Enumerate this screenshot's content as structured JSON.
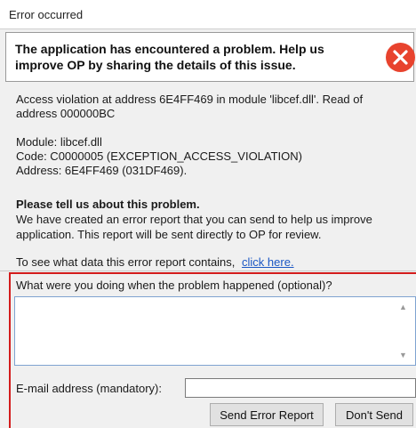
{
  "window": {
    "title": "Error occurred"
  },
  "header": {
    "message": "The application has encountered a problem. Help us improve OP by sharing the details of this issue.",
    "icon": "error-icon",
    "icon_color": "#e8432e"
  },
  "details": {
    "line1": "Access violation at address 6E4FF469 in module 'libcef.dll'. Read of",
    "line2": "address 000000BC",
    "module": "Module: libcef.dll",
    "code": "Code: C0000005 (EXCEPTION_ACCESS_VIOLATION)",
    "address": "Address: 6E4FF469 (031DF469)."
  },
  "prompt": {
    "title": "Please tell us about this problem.",
    "description": "We have created an error report that you can send to help us improve application.  This report will be sent directly to OP for review."
  },
  "data_link": {
    "text": "To see what data this error report contains,",
    "link_label": "click here."
  },
  "form": {
    "question_label": "What were you doing when the problem happened (optional)?",
    "question_value": "",
    "email_label": "E-mail address (mandatory):",
    "email_value": ""
  },
  "buttons": {
    "send": "Send Error Report",
    "dont_send": "Don't Send"
  },
  "colors": {
    "highlight_border": "#d31c1c",
    "link": "#1a56c4"
  }
}
